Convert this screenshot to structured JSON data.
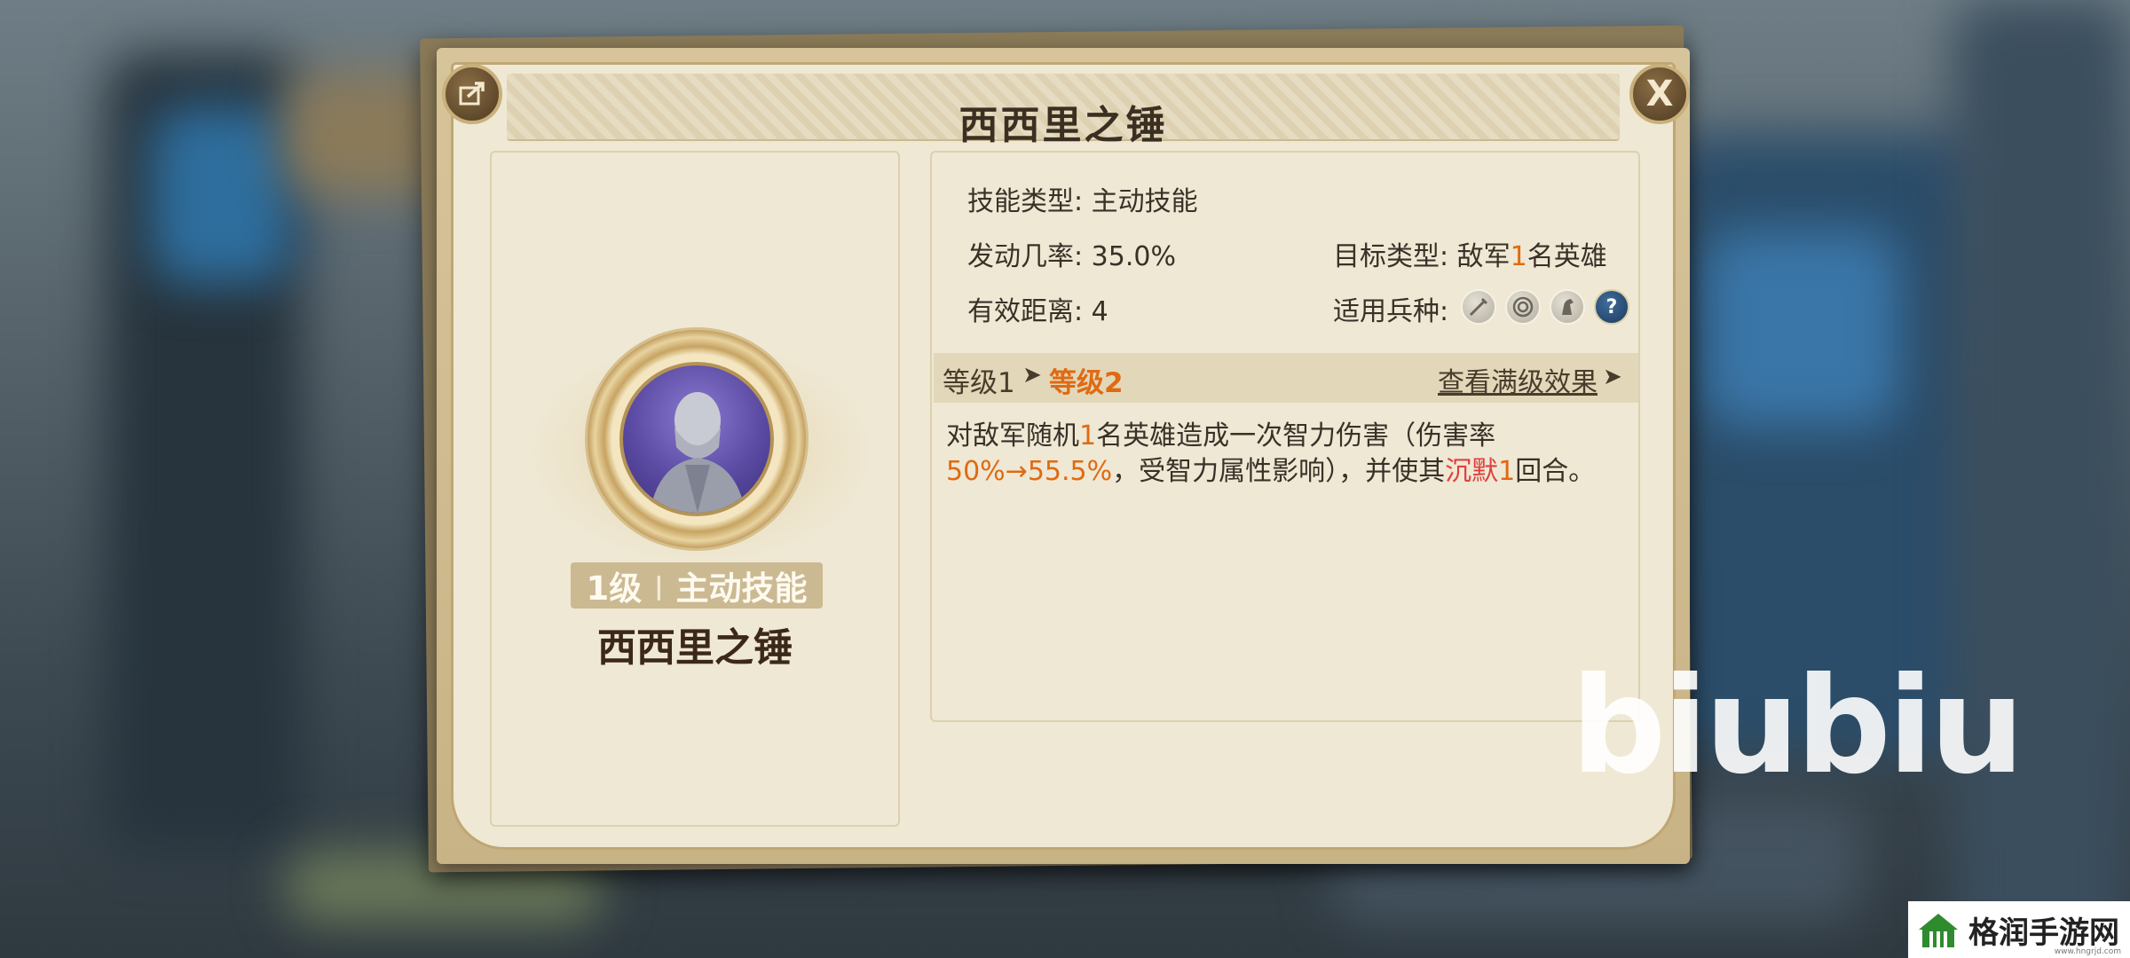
{
  "dialog": {
    "title": "西西里之锤",
    "close_label": "X"
  },
  "skill": {
    "level_label": "1级",
    "separator": "|",
    "type_label": "主动技能",
    "name": "西西里之锤"
  },
  "info": {
    "skill_type_label": "技能类型:",
    "skill_type_value": "主动技能",
    "trigger_rate_label": "发动几率:",
    "trigger_rate_value": "35.0%",
    "range_label": "有效距离:",
    "range_value": "4",
    "target_type_label": "目标类型:",
    "target_type_prefix": "敌军",
    "target_type_count": "1",
    "target_type_suffix": "名英雄",
    "unit_types_label": "适用兵种:",
    "unit_icons": [
      "sword-icon",
      "target-icon",
      "horse-icon",
      "question-icon"
    ],
    "question_glyph": "?"
  },
  "levels": {
    "current": "等级1",
    "next": "等级2",
    "view_max": "查看满级效果"
  },
  "description": {
    "p1": "对敌军随机",
    "n1": "1",
    "p2": "名英雄造成一次智力伤害（伤害率",
    "rate_from": "50%",
    "rate_to": "→55.5%",
    "p3": "，受智力属性影响），并使其",
    "status": "沉默",
    "n2": "1",
    "p4": "回合。"
  },
  "watermarks": {
    "overlay": "biubiu",
    "site_name": "格润手游网",
    "site_url": "www.hngrjd.com"
  },
  "colors": {
    "highlight_orange": "#e06a12",
    "highlight_red": "#e04040",
    "parchment": "#efe8d4"
  }
}
